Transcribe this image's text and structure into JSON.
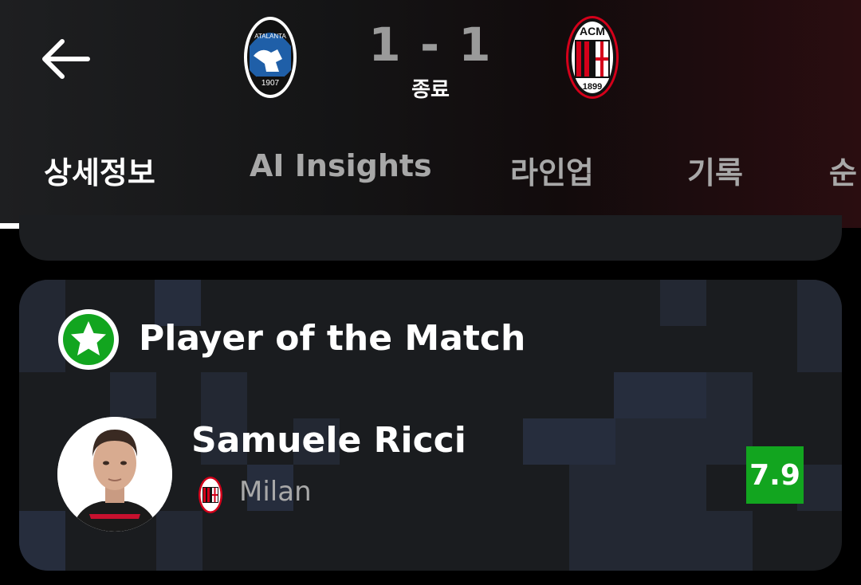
{
  "match": {
    "home_team_crest": "atalanta-crest",
    "home_crest_text": "ATALANTA",
    "home_crest_year": "1907",
    "away_team_crest": "ac-milan-crest",
    "away_crest_text": "ACM",
    "away_crest_year": "1899",
    "score": "1 - 1",
    "status": "종료"
  },
  "tabs": [
    {
      "label": "상세정보",
      "active": true
    },
    {
      "label": "AI Insights",
      "active": false
    },
    {
      "label": "라인업",
      "active": false
    },
    {
      "label": "기록",
      "active": false
    },
    {
      "label": "순",
      "active": false
    }
  ],
  "potm": {
    "title": "Player of the Match",
    "player_name": "Samuele Ricci",
    "team": "Milan",
    "rating": "7.9"
  },
  "colors": {
    "rating_bg": "#12a51f",
    "badge_green": "#12a51f",
    "milan_red": "#d4001a"
  }
}
